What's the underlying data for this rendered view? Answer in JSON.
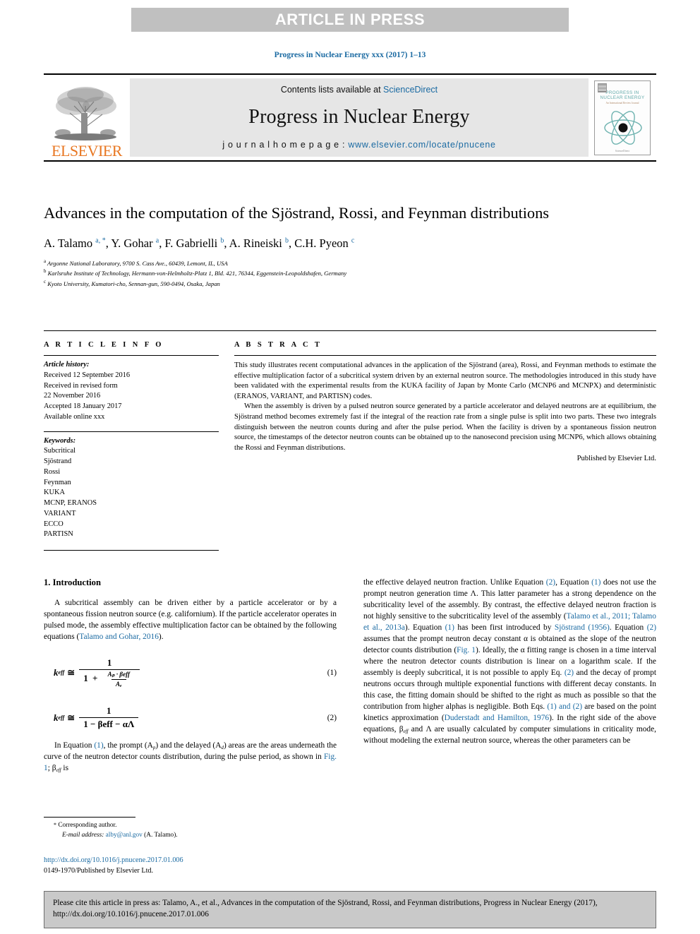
{
  "banner": {
    "text": "ARTICLE IN PRESS"
  },
  "journal_ref": "Progress in Nuclear Energy xxx (2017) 1–13",
  "masthead": {
    "contents_prefix": "Contents lists available at ",
    "sciencedirect": "ScienceDirect",
    "journal_title": "Progress in Nuclear Energy",
    "homepage_label": "j o u r n a l   h o m e p a g e :  ",
    "homepage_url": "www.elsevier.com/locate/pnucene",
    "publisher_logo_text": "ELSEVIER",
    "cover": {
      "line1": "PROGRESS IN",
      "line2": "NUCLEAR ENERGY",
      "line3": "An International Review Journal",
      "footer": "ScienceDirect"
    }
  },
  "article": {
    "title": "Advances in the computation of the Sjöstrand, Rossi, and Feynman distributions",
    "authors": [
      {
        "name": "A. Talamo",
        "marks": "a, *"
      },
      {
        "name": "Y. Gohar",
        "marks": "a"
      },
      {
        "name": "F. Gabrielli",
        "marks": "b"
      },
      {
        "name": "A. Rineiski",
        "marks": "b"
      },
      {
        "name": "C.H. Pyeon",
        "marks": "c"
      }
    ],
    "affiliations": [
      {
        "mark": "a",
        "text": "Argonne National Laboratory, 9700 S. Cass Ave., 60439, Lemont, IL, USA"
      },
      {
        "mark": "b",
        "text": "Karlsruhe Institute of Technology, Hermann-von-Helmholtz-Platz 1, Bld. 421, 76344, Eggenstein-Leopoldshafen, Germany"
      },
      {
        "mark": "c",
        "text": "Kyoto University, Kumatori-cho, Sennan-gun, 590-0494, Osaka, Japan"
      }
    ]
  },
  "info": {
    "heading": "A R T I C L E  I N F O",
    "history_label": "Article history:",
    "history": [
      "Received 12 September 2016",
      "Received in revised form",
      "22 November 2016",
      "Accepted 18 January 2017",
      "Available online xxx"
    ],
    "keywords_label": "Keywords:",
    "keywords": [
      "Subcritical",
      "Sjöstrand",
      "Rossi",
      "Feynman",
      "KUKA",
      "MCNP, ERANOS",
      "VARIANT",
      "ECCO",
      "PARTISN"
    ]
  },
  "abstract": {
    "heading": "A B S T R A C T",
    "paragraphs": [
      "This study illustrates recent computational advances in the application of the Sjöstrand (area), Rossi, and Feynman methods to estimate the effective multiplication factor of a subcritical system driven by an external neutron source. The methodologies introduced in this study have been validated with the experimental results from the KUKA facility of Japan by Monte Carlo (MCNP6 and MCNPX) and deterministic (ERANOS, VARIANT, and PARTISN) codes.",
      "When the assembly is driven by a pulsed neutron source generated by a particle accelerator and delayed neutrons are at equilibrium, the Sjöstrand method becomes extremely fast if the integral of the reaction rate from a single pulse is split into two parts. These two integrals distinguish between the neutron counts during and after the pulse period. When the facility is driven by a spontaneous fission neutron source, the timestamps of the detector neutron counts can be obtained up to the nanosecond precision using MCNP6, which allows obtaining the Rossi and Feynman distributions."
    ],
    "published_by": "Published by Elsevier Ltd."
  },
  "body": {
    "section_number_title": "1. Introduction",
    "left_para_1_a": "A subcritical assembly can be driven either by a particle accelerator or by a spontaneous fission neutron source (e.g. californium). If the particle accelerator operates in pulsed mode, the assembly effective multiplication factor can be obtained by the following equations (",
    "left_para_1_cite": "Talamo and Gohar, 2016",
    "left_para_1_b": ").",
    "equations": [
      {
        "number": "(1)",
        "lhs": "k",
        "lhs_sub": "eff",
        "rel": "≅"
      },
      {
        "number": "(2)",
        "lhs": "k",
        "lhs_sub": "eff",
        "rel": "≅"
      }
    ],
    "eq1": {
      "num": "1",
      "den_one": "1",
      "den_plus": "+",
      "frac_num": "Aₚ · βeff",
      "frac_den": "Aₑ"
    },
    "eq2": {
      "num": "1",
      "den": "1 − βeff − αΛ"
    },
    "left_para_2_a": "In Equation ",
    "left_para_2_eq": "(1)",
    "left_para_2_b": ", the prompt (A",
    "left_para_2_c": ") and the delayed (A",
    "left_para_2_d": ") areas are the areas underneath the curve of the neutron detector counts distribution, during the pulse period, as shown in ",
    "left_para_2_fig": "Fig. 1",
    "left_para_2_e": "; β",
    "left_para_2_f": " is",
    "right_text_1": "the effective delayed neutron fraction. Unlike Equation ",
    "right_eq2a": "(2)",
    "right_text_2": ", Equation ",
    "right_eq1a": "(1)",
    "right_text_3": " does not use the prompt neutron generation time Λ. This latter parameter has a strong dependence on the subcriticality level of the assembly. By contrast, the effective delayed neutron fraction is not highly sensitive to the subcriticality level of the assembly (",
    "right_cite_1": "Talamo et al., 2011; Talamo et al., 2013a",
    "right_text_4": "). Equation ",
    "right_eq1b": "(1)",
    "right_text_5": " has been first introduced by ",
    "right_cite_2": "Sjöstrand (1956)",
    "right_text_6": ". Equation ",
    "right_eq2b": "(2)",
    "right_text_7": " assumes that the prompt neutron decay constant α is obtained as the slope of the neutron detector counts distribution (",
    "right_fig_1": "Fig. 1",
    "right_text_8": "). Ideally, the α fitting range is chosen in a time interval where the neutron detector counts distribution is linear on a logarithm scale. If the assembly is deeply subcritical, it is not possible to apply Eq. ",
    "right_eq2c": "(2)",
    "right_text_9": " and the decay of prompt neutrons occurs through multiple exponential functions with different decay constants. In this case, the fitting domain should be shifted to the right as much as possible so that the contribution from higher alphas is negligible. Both Eqs. ",
    "right_eq12": "(1) and (2)",
    "right_text_10": " are based on the point kinetics approximation (",
    "right_cite_3": "Duderstadt and Hamilton, 1976",
    "right_text_11": "). In the right side of the above equations, β",
    "right_text_12": " and Λ are usually calculated by computer simulations in criticality mode, without modeling the external neutron source, whereas the other parameters can be"
  },
  "footnote": {
    "star": "*",
    "corresponding": " Corresponding author.",
    "email_label": "E-mail address:",
    "email": "alby@anl.gov",
    "email_owner": " (A. Talamo)."
  },
  "doi_block": {
    "doi_url": "http://dx.doi.org/10.1016/j.pnucene.2017.01.006",
    "issn_line": "0149-1970/Published by Elsevier Ltd."
  },
  "citation_footer": "Please cite this article in press as: Talamo, A., et al., Advances in the computation of the Sjöstrand, Rossi, and Feynman distributions, Progress in Nuclear Energy (2017), http://dx.doi.org/10.1016/j.pnucene.2017.01.006",
  "colors": {
    "link": "#1a6aa2",
    "banner_bg": "#c0c0c0",
    "elsevier_orange": "#E87722",
    "masthead_bg": "#e6e6e6",
    "footer_bg": "#c9c9c9"
  }
}
